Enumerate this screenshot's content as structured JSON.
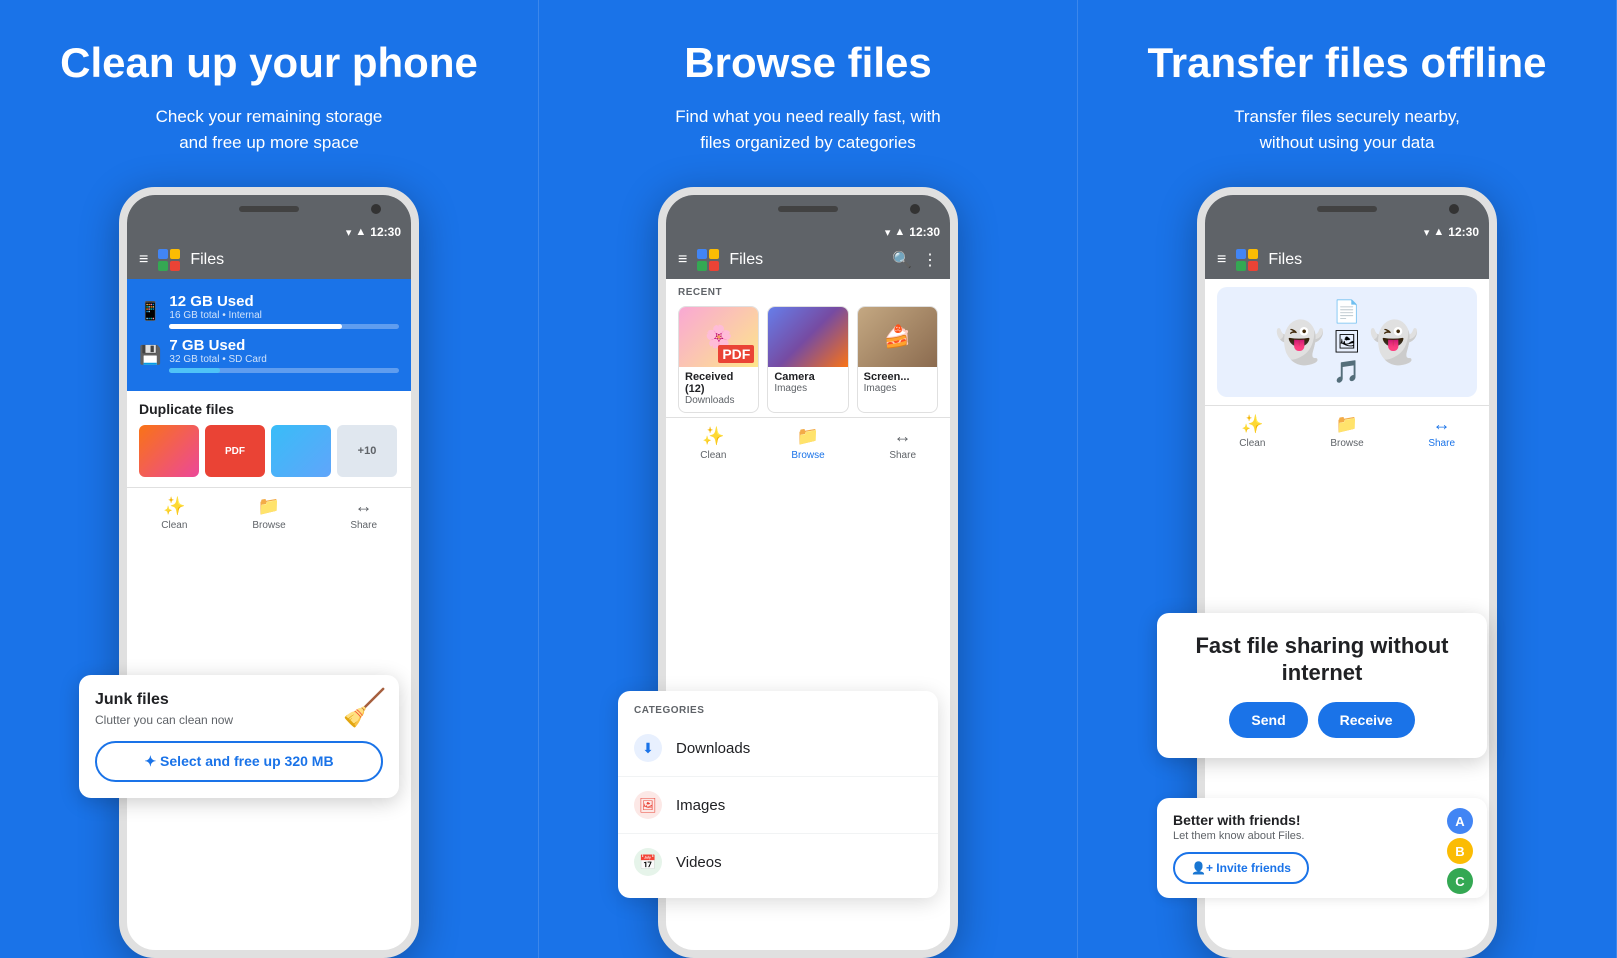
{
  "panels": [
    {
      "id": "clean",
      "title": "Clean up your phone",
      "subtitle": "Check your remaining storage\nand free up more space",
      "phone": {
        "time": "12:30",
        "appTitle": "Files",
        "storage": [
          {
            "label": "12 GB Used",
            "sub": "16 GB total • Internal",
            "fill": 75
          },
          {
            "label": "7 GB Used",
            "sub": "32 GB total • SD Card",
            "fill": 22
          }
        ],
        "junk": {
          "title": "Junk files",
          "sub": "Clutter you can clean now",
          "btn": "✦  Select and free up 320 MB"
        },
        "duplicates": {
          "title": "Duplicate files"
        },
        "bottomNav": [
          {
            "label": "Clean",
            "active": false,
            "icon": "✨"
          },
          {
            "label": "Browse",
            "active": false,
            "icon": "📁"
          },
          {
            "label": "Share",
            "active": false,
            "icon": "↔"
          }
        ]
      }
    },
    {
      "id": "browse",
      "title": "Browse files",
      "subtitle": "Find what you need really fast, with\nfiles organized by categories",
      "phone": {
        "time": "12:30",
        "appTitle": "Files",
        "recentLabel": "RECENT",
        "recentItems": [
          {
            "name": "Received (12)",
            "type": "Downloads",
            "style": "flower"
          },
          {
            "name": "Camera",
            "type": "Images",
            "style": "sunset"
          },
          {
            "name": "Screen...",
            "type": "Images",
            "style": "food"
          }
        ],
        "categoriesLabel": "CATEGORIES",
        "categories": [
          {
            "name": "Downloads",
            "icon": "⬇",
            "style": "dl"
          },
          {
            "name": "Images",
            "icon": "🖼",
            "style": "img"
          },
          {
            "name": "Videos",
            "icon": "📅",
            "style": "vid"
          }
        ],
        "bottomNav": [
          {
            "label": "Clean",
            "active": false,
            "icon": "✨"
          },
          {
            "label": "Browse",
            "active": true,
            "icon": "📁"
          },
          {
            "label": "Share",
            "active": false,
            "icon": "↔"
          }
        ]
      }
    },
    {
      "id": "transfer",
      "title": "Transfer files offline",
      "subtitle": "Transfer files securely nearby,\nwithout using your data",
      "phone": {
        "time": "12:30",
        "appTitle": "Files",
        "fastShare": {
          "title": "Fast file sharing without internet",
          "sendBtn": "Send",
          "receiveBtn": "Receive"
        },
        "friends": {
          "title": "Better with friends!",
          "sub": "Let them know about Files.",
          "inviteBtn": "👤+  Invite friends"
        },
        "bottomNav": [
          {
            "label": "Clean",
            "active": false,
            "icon": "✨"
          },
          {
            "label": "Browse",
            "active": false,
            "icon": "📁"
          },
          {
            "label": "Share",
            "active": true,
            "icon": "↔"
          }
        ]
      }
    }
  ]
}
